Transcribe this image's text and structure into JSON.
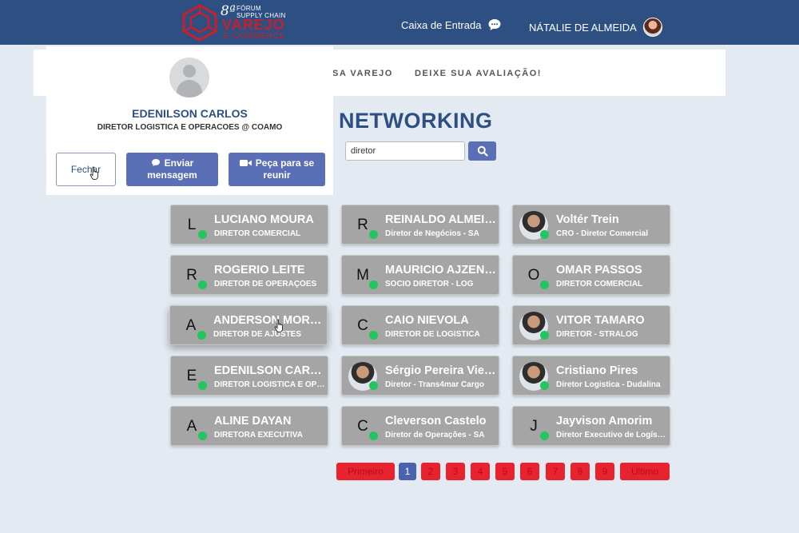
{
  "header": {
    "logo": {
      "edition": "8ª",
      "line1": "FÓRUM",
      "line2": "SUPPLY CHAIN",
      "brand": "VAREJO",
      "brand_sub": "E-COMMERCE"
    },
    "inbox_label": "Caixa de Entrada",
    "user_name": "NÁTALIE DE ALMEIDA"
  },
  "nav": {
    "items": [
      "SA VAREJO",
      "DEIXE SUA AVALIAÇÃO!"
    ]
  },
  "page": {
    "title": "NETWORKING",
    "search": {
      "value": "diretor"
    }
  },
  "cards": [
    {
      "initial": "L",
      "name": "LUCIANO MOURA",
      "role": "DIRETOR COMERCIAL",
      "photo": false
    },
    {
      "initial": "R",
      "name": "REINALDO ALMEIDA",
      "role": "Diretor de Negócios - SA",
      "photo": false
    },
    {
      "initial": "",
      "name": "Voltér Trein",
      "role": "CRO - Diretor Comercial",
      "photo": true
    },
    {
      "initial": "R",
      "name": "ROGERIO LEITE",
      "role": "DIRETOR DE OPERAÇÕES",
      "photo": false
    },
    {
      "initial": "M",
      "name": "MAURICIO AJZENBERG",
      "role": "SOCIO DIRETOR - LOG",
      "photo": false
    },
    {
      "initial": "O",
      "name": "OMAR PASSOS",
      "role": "DIRETOR COMERCIAL",
      "photo": false
    },
    {
      "initial": "A",
      "name": "ANDERSON MOREIRA",
      "role": "DIRETOR DE AJUSTES",
      "photo": false
    },
    {
      "initial": "C",
      "name": "CAIO NIEVOLA",
      "role": "DIRETOR DE LOGÍSTICA",
      "photo": false
    },
    {
      "initial": "",
      "name": "VITOR TAMARO",
      "role": "DIRETOR - STRALOG",
      "photo": true
    },
    {
      "initial": "E",
      "name": "EDENILSON CARLOS",
      "role": "DIRETOR LOGISTICA E OPERACOES",
      "photo": false
    },
    {
      "initial": "",
      "name": "Sérgio Pereira Vieira",
      "role": "Diretor - Trans4mar Cargo",
      "photo": true
    },
    {
      "initial": "",
      "name": "Cristiano Pires",
      "role": "Diretor Logistica - Dudalina",
      "photo": true
    },
    {
      "initial": "A",
      "name": "ALINE DAYAN",
      "role": "DIRETORA EXECUTIVA",
      "photo": false
    },
    {
      "initial": "C",
      "name": "Cleverson Castelo",
      "role": "Diretor de Operações - SA",
      "photo": false
    },
    {
      "initial": "J",
      "name": "Jayvison Amorim",
      "role": "Diretor Executivo de Logística",
      "photo": false
    }
  ],
  "pagination": {
    "first": "Primeiro",
    "pages": [
      "1",
      "2",
      "3",
      "4",
      "5",
      "6",
      "7",
      "8",
      "9"
    ],
    "active": "1",
    "last": "Último"
  },
  "popup": {
    "name": "EDENILSON CARLOS",
    "role": "DIRETOR LOGISTICA E OPERACOES @ COAMO",
    "close_label": "Fechar",
    "message_label": "Enviar mensagem",
    "meet_label": "Peça para se reunir"
  },
  "colors": {
    "header_bg": "#2d4f82",
    "accent": "#5a6fb5",
    "card_bg": "#a5a5a5",
    "online": "#22c55e",
    "pagination": "#e8232f"
  }
}
